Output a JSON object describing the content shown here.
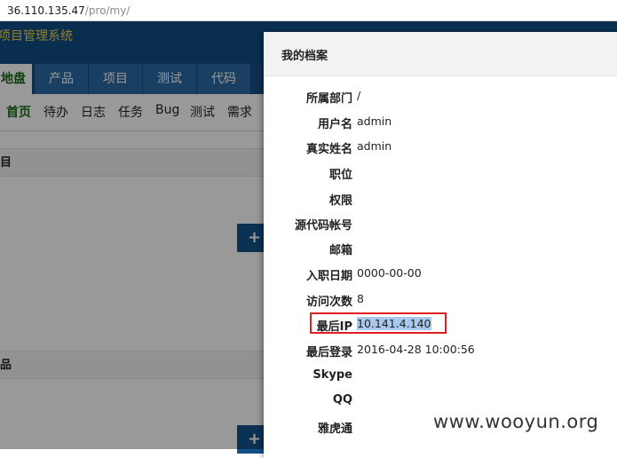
{
  "browser": {
    "url_host": "36.110.135.47",
    "url_path": "/pro/my/"
  },
  "app": {
    "title": "项目管理系统",
    "main_nav": [
      {
        "label": "地盘",
        "active": true
      },
      {
        "label": "产品",
        "active": false
      },
      {
        "label": "项目",
        "active": false
      },
      {
        "label": "测试",
        "active": false
      },
      {
        "label": "代码",
        "active": false
      }
    ],
    "sub_nav": [
      {
        "label": "首页",
        "active": true
      },
      {
        "label": "待办",
        "active": false
      },
      {
        "label": "日志",
        "active": false
      },
      {
        "label": "任务",
        "active": false
      },
      {
        "label": "Bug",
        "active": false
      },
      {
        "label": "测试",
        "active": false
      },
      {
        "label": "需求",
        "active": false
      }
    ],
    "panel_project_title": "目",
    "panel_product_title": "品",
    "add_button_icon": "plus-icon"
  },
  "modal": {
    "title": "我的档案",
    "fields": [
      {
        "label": "所属部门",
        "value": "/"
      },
      {
        "label": "用户名",
        "value": "admin"
      },
      {
        "label": "真实姓名",
        "value": "admin"
      },
      {
        "label": "职位",
        "value": ""
      },
      {
        "label": "权限",
        "value": ""
      },
      {
        "label": "源代码帐号",
        "value": ""
      },
      {
        "label": "邮箱",
        "value": ""
      },
      {
        "label": "入职日期",
        "value": "0000-00-00"
      },
      {
        "label": "访问次数",
        "value": "8"
      },
      {
        "label": "最后IP",
        "value": "10.141.4.140"
      },
      {
        "label": "最后登录",
        "value": "2016-04-28 10:00:56"
      },
      {
        "label": "Skype",
        "value": ""
      },
      {
        "label": "QQ",
        "value": ""
      },
      {
        "label": "雅虎通",
        "value": ""
      }
    ]
  },
  "watermark": "www.wooyun.org",
  "colors": {
    "header_blue": "#0f4d86",
    "active_green": "#1a6a16",
    "title_yellow": "#f0d64a",
    "highlight_red": "#e02020",
    "selection_blue": "#a9c9ec"
  }
}
